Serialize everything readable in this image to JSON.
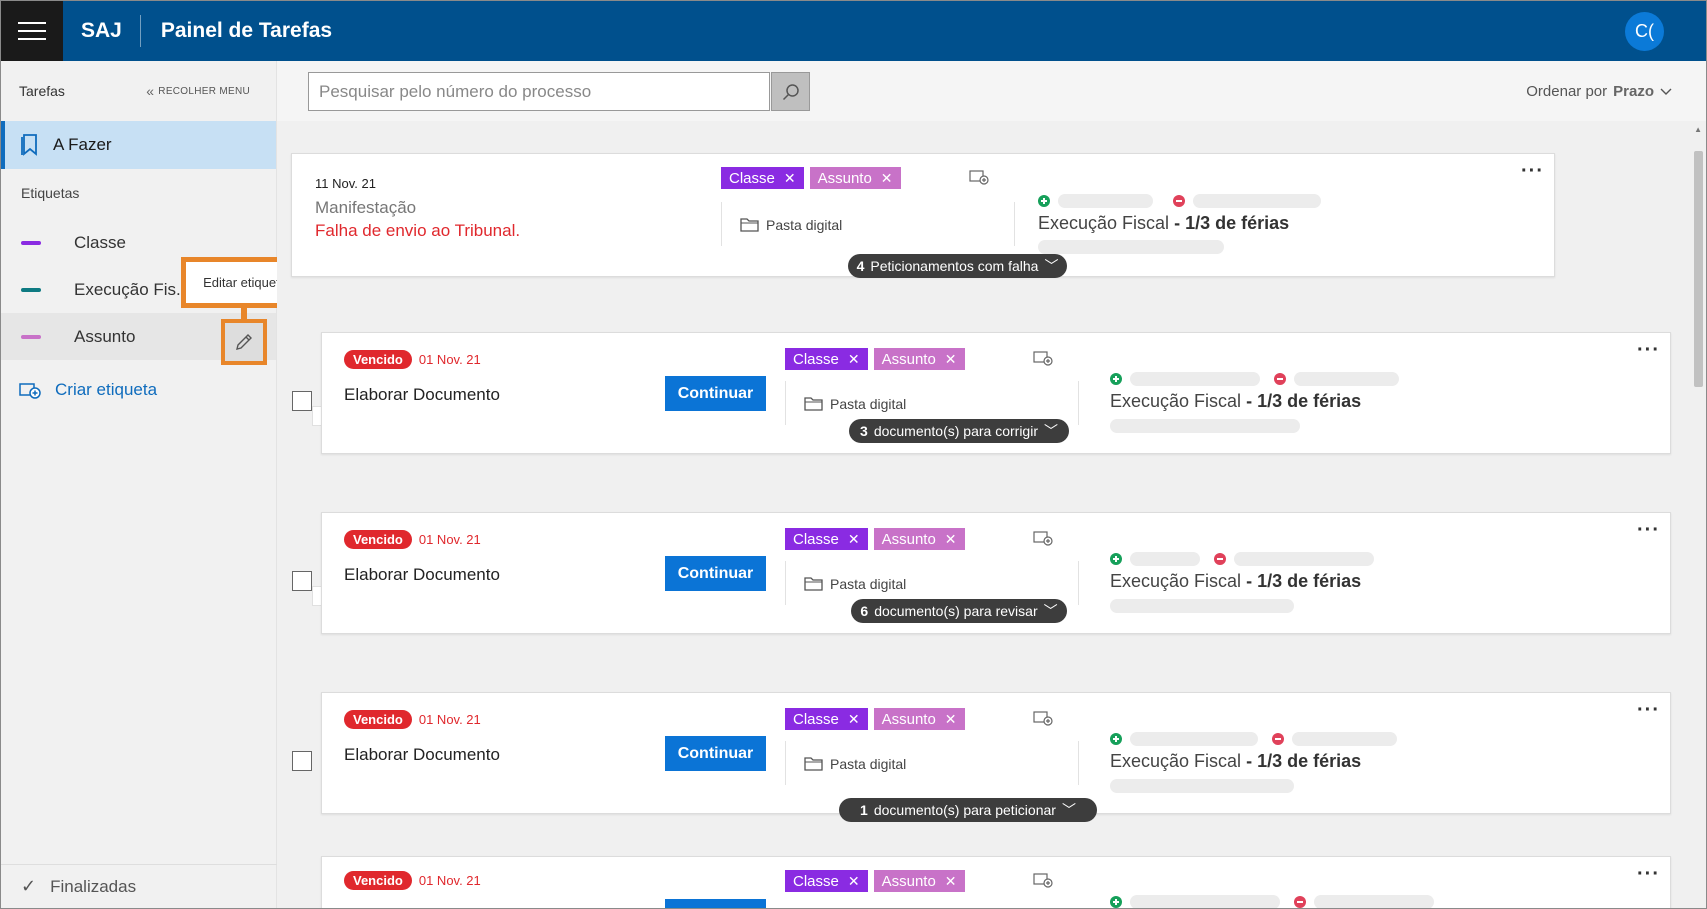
{
  "header": {
    "brand": "SAJ",
    "title": "Painel de Tarefas",
    "avatar_initials": "C("
  },
  "sidebar": {
    "title": "Tarefas",
    "collapse_label": "RECOLHER MENU",
    "active_item": "A Fazer",
    "labels_section": "Etiquetas",
    "labels": [
      {
        "name": "Classe",
        "color": "#8a2be2"
      },
      {
        "name": "Execução Fis...",
        "color": "#0e7a82"
      },
      {
        "name": "Assunto",
        "color": "#c872c8"
      }
    ],
    "create_label": "Criar etiqueta",
    "finished_label": "Finalizadas",
    "tooltip": "Editar etiqueta"
  },
  "toolbar": {
    "search_placeholder": "Pesquisar pelo número do processo",
    "sort_prefix": "Ordenar por",
    "sort_value": "Prazo"
  },
  "tags": {
    "classe": "Classe",
    "assunto": "Assunto",
    "classe_color": "#8a2be2",
    "assunto_color": "#c872c8"
  },
  "common": {
    "pasta": "Pasta digital",
    "continuar": "Continuar",
    "vencido": "Vencido",
    "class_prefix": "Execução Fiscal",
    "class_suffix": "1/3 de férias",
    "separator": " - "
  },
  "cards": [
    {
      "date": "11 Nov. 21",
      "subtitle": "Manifestação",
      "error": "Falha de envio ao Tribunal.",
      "pill_count": "4",
      "pill_text": "Peticionamentos com falha"
    },
    {
      "date": "01 Nov. 21",
      "title": "Elaborar Documento",
      "pill_count": "3",
      "pill_text": "documento(s) para corrigir"
    },
    {
      "date": "01 Nov. 21",
      "title": "Elaborar Documento",
      "pill_count": "6",
      "pill_text": "documento(s) para revisar"
    },
    {
      "date": "01 Nov. 21",
      "title": "Elaborar Documento",
      "pill_count": "1",
      "pill_text": "documento(s) para peticionar"
    },
    {
      "date": "01 Nov. 21"
    }
  ]
}
